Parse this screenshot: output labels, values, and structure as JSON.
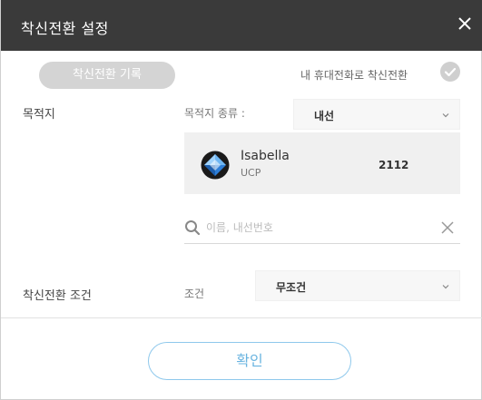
{
  "dialog": {
    "title": "착신전환 설정",
    "close_icon": "close-icon"
  },
  "history_button": {
    "label": "착신전환 기록"
  },
  "forward_to_mobile": {
    "label": "내 휴대전화로 착신전환",
    "checked": false
  },
  "destination": {
    "label": "목적지",
    "type_label": "목적지 종류 :",
    "type_select": {
      "value": "내선"
    }
  },
  "selected_contact": {
    "name": "Isabella",
    "sub": "UCP",
    "number": "2112",
    "avatar_icon": "blue-diamond-avatar-icon"
  },
  "search": {
    "placeholder": "이름, 내선번호",
    "value": ""
  },
  "condition": {
    "label": "착신전환 조건",
    "field_label": "조건",
    "select": {
      "value": "무조건"
    }
  },
  "confirm_button": {
    "label": "확인"
  },
  "colors": {
    "title_bar": "#3a3a3a",
    "confirm_accent": "#6ab4e0",
    "pill_button": "#d4d4d4",
    "card_bg": "#f0f0f0"
  }
}
